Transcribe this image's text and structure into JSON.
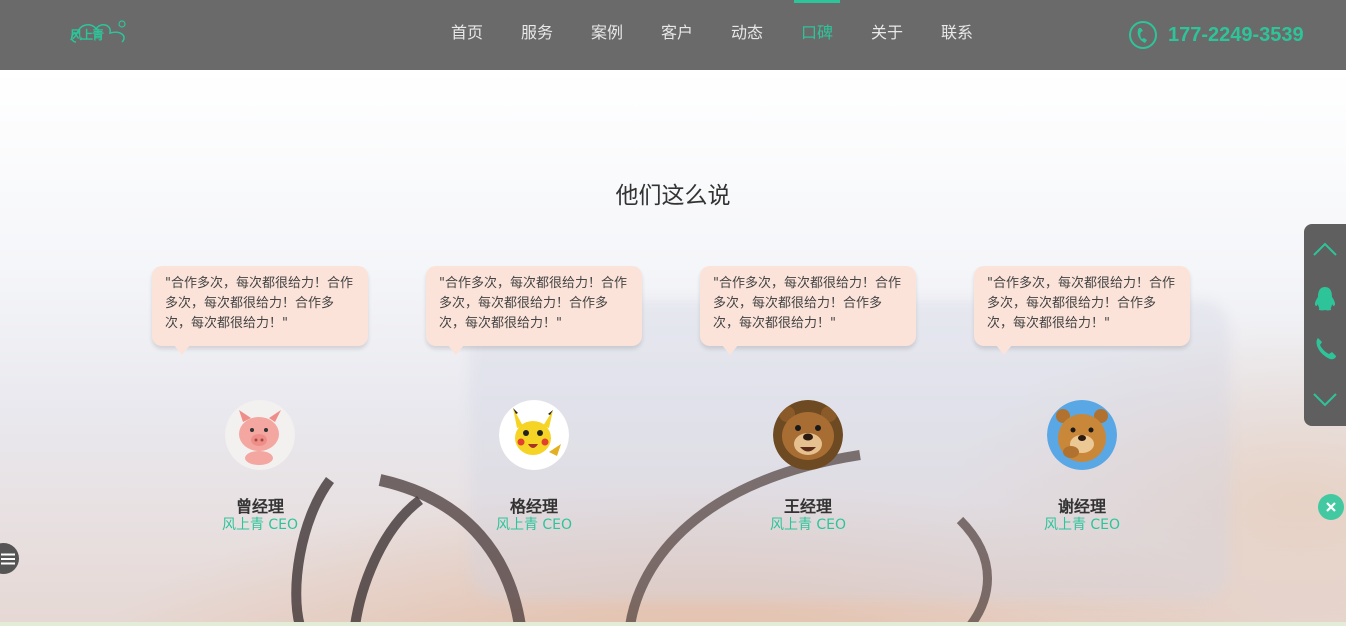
{
  "header": {
    "logo_text": "风上青",
    "nav": [
      {
        "label": "首页",
        "active": false
      },
      {
        "label": "服务",
        "active": false
      },
      {
        "label": "案例",
        "active": false
      },
      {
        "label": "客户",
        "active": false
      },
      {
        "label": "动态",
        "active": false
      },
      {
        "label": "口碑",
        "active": true
      },
      {
        "label": "关于",
        "active": false
      },
      {
        "label": "联系",
        "active": false
      }
    ],
    "phone": "177-2249-3539"
  },
  "section": {
    "title": "他们这么说",
    "testimonials": [
      {
        "quote": "\"合作多次，每次都很给力！合作多次，每次都很给力！合作多次，每次都很给力！\"",
        "name": "曾经理",
        "role": "风上青 CEO",
        "avatar": "pig-avatar"
      },
      {
        "quote": "\"合作多次，每次都很给力！合作多次，每次都很给力！合作多次，每次都很给力！\"",
        "name": "格经理",
        "role": "风上青 CEO",
        "avatar": "pikachu-avatar"
      },
      {
        "quote": "\"合作多次，每次都很给力！合作多次，每次都很给力！合作多次，每次都很给力！\"",
        "name": "王经理",
        "role": "风上青 CEO",
        "avatar": "bear-avatar"
      },
      {
        "quote": "\"合作多次，每次都很给力！合作多次，每次都很给力！合作多次，每次都很给力！\"",
        "name": "谢经理",
        "role": "风上青 CEO",
        "avatar": "bear-thinking-avatar"
      }
    ]
  },
  "side_toolbar": {
    "buttons": [
      "chevron-up-icon",
      "qq-icon",
      "phone-icon",
      "chevron-down-icon"
    ]
  },
  "colors": {
    "accent": "#2ec49a",
    "header_bg": "#6a6a6a",
    "bubble_bg": "#fbe3da"
  }
}
